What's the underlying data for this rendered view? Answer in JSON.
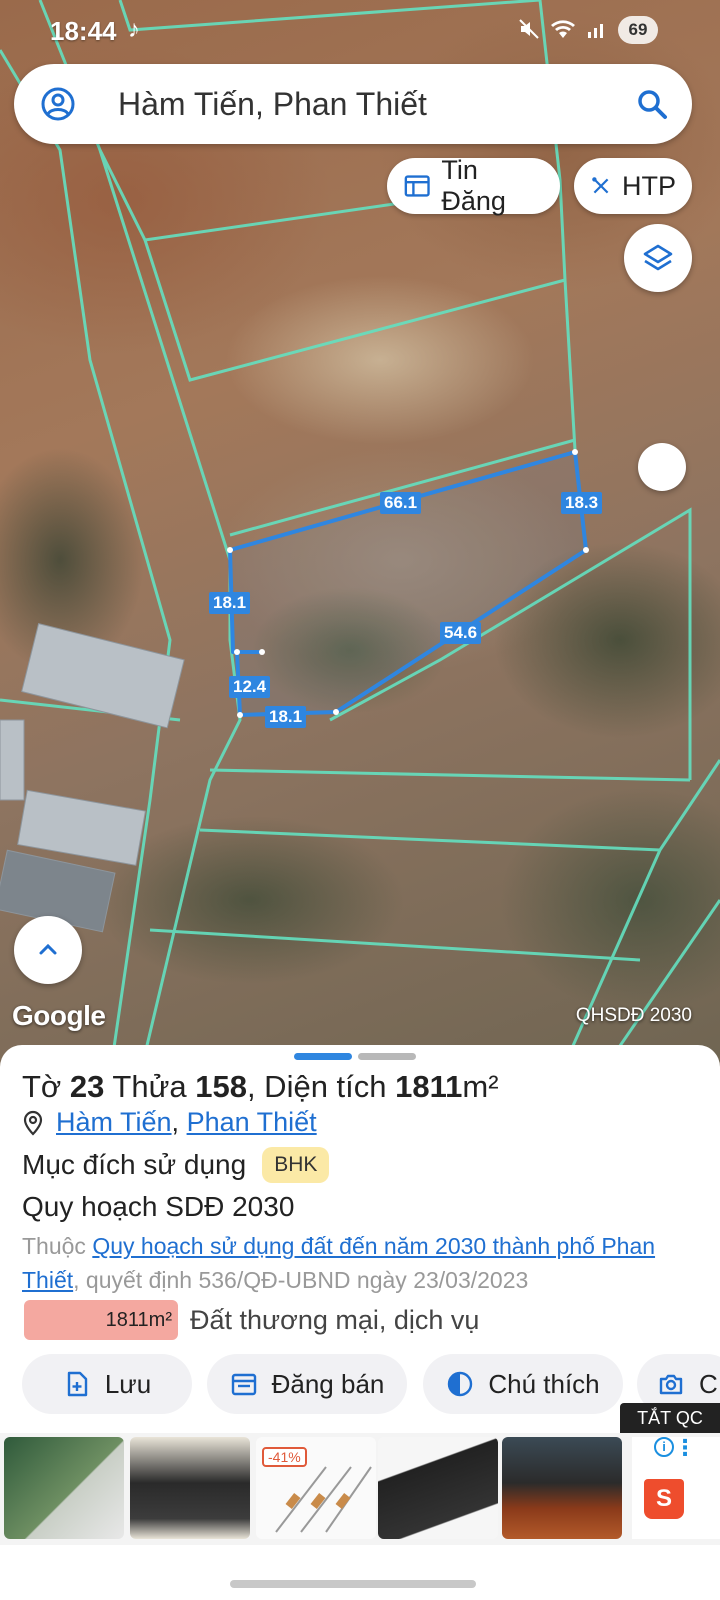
{
  "status_bar": {
    "time": "18:44",
    "battery": "69"
  },
  "search": {
    "query": "Hàm Tiến, Phan Thiết"
  },
  "chips": {
    "news": "Tin Đăng",
    "htp": "HTP"
  },
  "map": {
    "dimensions": [
      "66.1",
      "18.3",
      "18.1",
      "54.6",
      "12.4",
      "18.1"
    ],
    "google_logo": "Google",
    "plan_watermark": "QHSDĐ 2030"
  },
  "parcel": {
    "sheet_prefix": "Tờ ",
    "sheet_no": "23",
    "lot_prefix": " Thửa ",
    "lot_no": "158",
    "area_prefix": ", Diện tích ",
    "area": "1811",
    "area_unit": "m²",
    "ward": "Hàm Tiến",
    "separator": ",",
    "city": "Phan Thiết",
    "purpose_label": "Mục đích sử dụng",
    "purpose_code": "BHK",
    "plan_title": "Quy hoạch SDĐ 2030",
    "plan_prefix": "Thuộc ",
    "plan_link": "Quy hoạch sử dụng đất đến năm 2030 thành phố Phan Thiết",
    "plan_suffix": ", quyết định 536/QĐ-UBND ngày 23/03/2023",
    "legend_area": "1811m²",
    "legend_use": "Đất thương mại, dịch vụ",
    "legend_color": "#f4a8a0"
  },
  "actions": {
    "save": "Lưu",
    "sell": "Đăng bán",
    "legend": "Chú thích",
    "photo": "C"
  },
  "ad": {
    "close_label": "TẮT QC",
    "discount": "-41%",
    "info": "i"
  },
  "colors": {
    "accent": "#2f86e0",
    "parcel_lines": "#64e0c0",
    "link": "#1f6fd1"
  }
}
